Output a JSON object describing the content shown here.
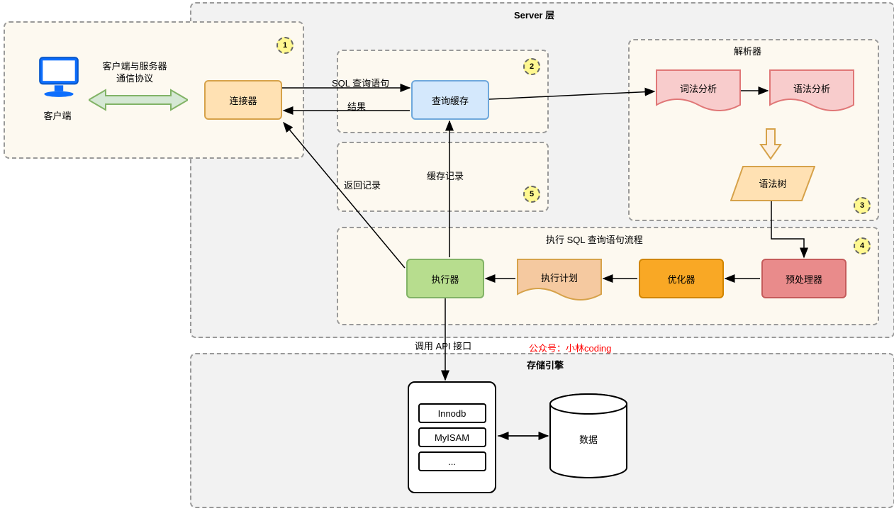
{
  "server_layer_title": "Server 层",
  "client_label": "客户端",
  "protocol_label_1": "客户端与服务器",
  "protocol_label_2": "通信协议",
  "connector": "连接器",
  "query_cache": "查询缓存",
  "sql_query_label": "SQL 查询语句",
  "result_label": "结果",
  "cache_record_label": "缓存记录",
  "return_record_label": "返回记录",
  "parser_title": "解析器",
  "lexical": "词法分析",
  "syntax": "语法分析",
  "parse_tree": "语法树",
  "exec_flow_title": "执行 SQL 查询语句流程",
  "preprocessor": "预处理器",
  "optimizer": "优化器",
  "exec_plan": "执行计划",
  "executor": "执行器",
  "api_label": "调用 API 接口",
  "storage_engine_title": "存储引擎",
  "credit_label": "公众号：小林coding",
  "innodb": "Innodb",
  "myisam": "MyISAM",
  "dots": "...",
  "data": "数据",
  "badges": {
    "b1": "1",
    "b2": "2",
    "b3": "3",
    "b4": "4",
    "b5": "5"
  }
}
